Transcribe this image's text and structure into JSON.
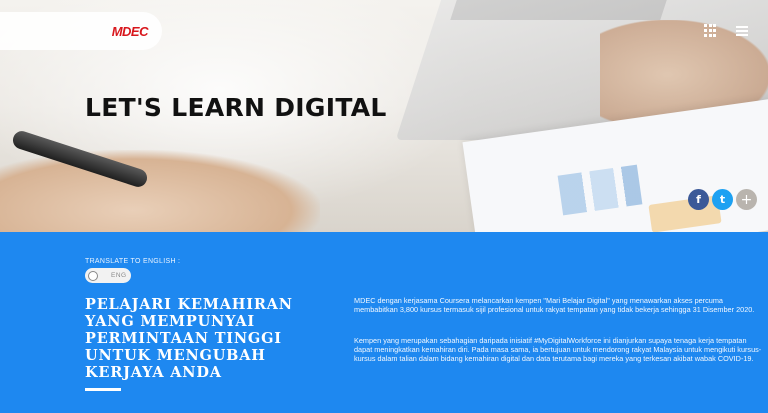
{
  "header": {
    "logo_text": "MDEC",
    "nav_icons": [
      "grid-icon",
      "menu-icon"
    ]
  },
  "hero": {
    "title": "LET'S LEARN DIGITAL"
  },
  "share": {
    "facebook_label": "f",
    "twitter_label": "t",
    "more_label": "+"
  },
  "translate": {
    "label": "TRANSLATE TO ENGLISH :",
    "toggle_text": "ENG"
  },
  "content": {
    "heading": "PELAJARI KEMAHIRAN YANG MEMPUNYAI PERMINTAAN TINGGI UNTUK MENGUBAH KERJAYA ANDA",
    "paragraph_1": "MDEC dengan kerjasama Coursera melancarkan kempen \"Mari Belajar Digital\" yang menawarkan akses percuma membabitkan 3,800 kursus termasuk sijil profesional untuk rakyat tempatan yang tidak bekerja sehingga 31 Disember 2020.",
    "paragraph_2": "Kempen yang merupakan sebahagian daripada inisiatif #MyDigitalWorkforce ini dianjurkan supaya tenaga kerja tempatan dapat meningkatkan kemahiran diri. Pada masa sama, ia bertujuan untuk mendorong rakyat Malaysia untuk mengikuti kursus-kursus dalam talian dalam bidang kemahiran digital dan data terutama bagi mereka yang terkesan akibat wabak COVID-19."
  },
  "colors": {
    "content_bg": "#1e88f0",
    "logo_red": "#d8161c",
    "facebook": "#3b5998",
    "twitter": "#1da1f2"
  }
}
